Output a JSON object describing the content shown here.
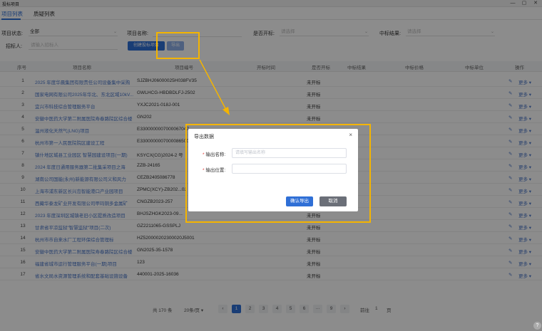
{
  "window": {
    "title": "投标项目",
    "minimize": "—",
    "maximize": "▢",
    "close": "✕"
  },
  "tabs": [
    {
      "label": "项目列表"
    },
    {
      "label": "质疑列表"
    }
  ],
  "filters": {
    "status_label": "项目状态:",
    "status_value": "全部",
    "name_label": "项目名称:",
    "public_label": "是否开标:",
    "public_placeholder": "请选择",
    "result_label": "中标结果:",
    "result_placeholder": "请选择",
    "bidder_label": "招标人:",
    "bidder_placeholder": "请输入招标人",
    "create_button": "创建投标项目",
    "export_button": "导出"
  },
  "table": {
    "headers": [
      "序号",
      "项目名称",
      "项目编号",
      "开标时间",
      "是否开标",
      "中标结果",
      "中标价格",
      "中标单位",
      "操作"
    ],
    "edit_icon": "✎",
    "more_label": "更多 ▾",
    "rows": [
      {
        "no": "1",
        "name": "2025 年度华晨集团有限责任公司设备集中采购",
        "code": "SJZBHJ06000025H038FV35",
        "status": "未开标"
      },
      {
        "no": "2",
        "name": "国家电网有限公司2025年华北、东北区域10kV...",
        "code": "GWLHCG-HBDBDLFJ-2502",
        "status": "未开标"
      },
      {
        "no": "3",
        "name": "宜兴市科技综合管理服务平台",
        "code": "YXJC2021-018J-001",
        "status": "未开标"
      },
      {
        "no": "4",
        "name": "安徽中医药大学第二附属医院寿春路院区综合楼",
        "code": "GN202",
        "status": "未开标"
      },
      {
        "no": "5",
        "name": "温州液化天然气(LNG)项目",
        "code": "E3300000007000067047",
        "status": ""
      },
      {
        "no": "6",
        "name": "杭州市第一人民医院院区建设工程",
        "code": "E3300000007000086500",
        "status": ""
      },
      {
        "no": "7",
        "name": "镇什地区城县工业园区 智慧园建设项目(一期)",
        "code": "KSYCX(CG)2024-2 号",
        "status": ""
      },
      {
        "no": "8",
        "name": "2024 年度日通用服务器第二批集采项目之海",
        "code": "ZZB-24165",
        "status": ""
      },
      {
        "no": "9",
        "name": "湖南公司国能(永州)新能源有限公司义和风力",
        "code": "CEZB2405086778",
        "status": ""
      },
      {
        "no": "10",
        "name": "上海市浦东新区长兴岛智能港口产业园项目",
        "code": "ZPMC(XCY)-ZB202...02",
        "status": ""
      },
      {
        "no": "11",
        "name": "西藏华泰龙矿业开发有限公司甲玛铜多金属矿",
        "code": "CNGZB2023-257",
        "status": ""
      },
      {
        "no": "12",
        "name": "2023 年度深圳区城镇老旧小区提质改造项目",
        "code": "BHJSZHGK2023-09...",
        "status": "未开标"
      },
      {
        "no": "13",
        "name": "甘肃省平凉监狱\"智慧监狱\"项目(二次)",
        "code": "GZ2211065-GSSPLJ",
        "status": "未开标"
      },
      {
        "no": "14",
        "name": "杭州市市自来水厂工程环保综合管理标",
        "code": "HZ520000202300020J5001",
        "status": "未开标"
      },
      {
        "no": "15",
        "name": "安徽中医药大学第二附属医院寿春路院区综合楼",
        "code": "GN2025-35-1578",
        "status": "未开标"
      },
      {
        "no": "16",
        "name": "福建省城市运行管理服务平台(一期)项目",
        "code": "123",
        "status": "未开标"
      },
      {
        "no": "17",
        "name": "省水文局水资源管理系统和配套基础设施设备",
        "code": "440001-2025-16036",
        "status": "未开标"
      }
    ]
  },
  "pagination": {
    "total": "共 170 条",
    "page_size": "20条/页 ▾",
    "prev": "‹",
    "next": "›",
    "pages": [
      "1",
      "2",
      "3",
      "4",
      "5",
      "6",
      "···",
      "9"
    ],
    "goto_label": "前往",
    "goto_value": "1",
    "goto_unit": "页"
  },
  "dialog": {
    "title": "导出数据",
    "close": "×",
    "name_label": "输出名称:",
    "name_placeholder": "请填写输出名称",
    "path_label": "输出位置:",
    "path_value": "",
    "ok_button": "确认导出",
    "cancel_button": "取消"
  }
}
